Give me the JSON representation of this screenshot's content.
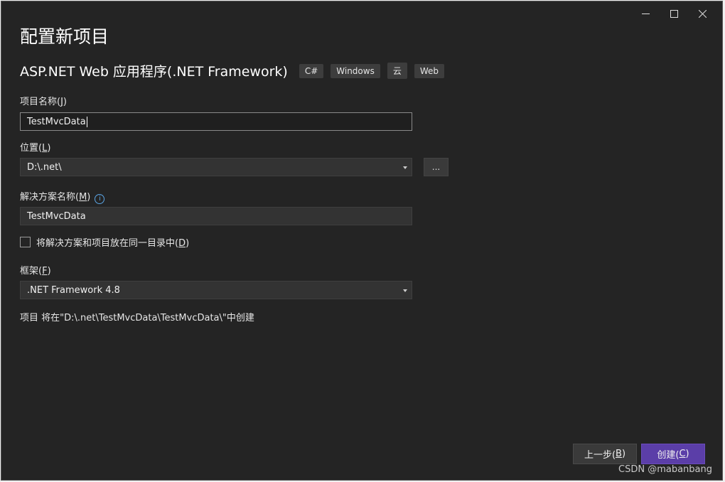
{
  "window": {
    "title": "配置新项目",
    "controls": {
      "minimize_icon": "minimize-icon",
      "maximize_icon": "maximize-icon",
      "close_icon": "close-icon"
    }
  },
  "project_type": {
    "name": "ASP.NET Web 应用程序(.NET Framework)",
    "tags": [
      "C#",
      "Windows",
      "云",
      "Web"
    ]
  },
  "form": {
    "project_name": {
      "label": "项目名称(",
      "mnemonic": "J",
      "label_end": ")",
      "value": "TestMvcData"
    },
    "location": {
      "label": "位置(",
      "mnemonic": "L",
      "label_end": ")",
      "value": "D:\\.net\\",
      "browse_label": "..."
    },
    "solution_name": {
      "label": "解决方案名称(",
      "mnemonic": "M",
      "label_end": ")",
      "value": "TestMvcData",
      "info_icon": "info-icon"
    },
    "same_dir": {
      "label": "将解决方案和项目放在同一目录中(",
      "mnemonic": "D",
      "label_end": ")",
      "checked": false
    },
    "framework": {
      "label": "框架(",
      "mnemonic": "F",
      "label_end": ")",
      "value": ".NET Framework 4.8"
    },
    "path_note": "项目 将在\"D:\\.net\\TestMvcData\\TestMvcData\\\"中创建"
  },
  "buttons": {
    "back": {
      "label": "上一步(",
      "mnemonic": "B",
      "label_end": ")"
    },
    "create": {
      "label": "创建(",
      "mnemonic": "C",
      "label_end": ")"
    }
  },
  "watermark": "CSDN @mabanbang",
  "colors": {
    "background": "#242424",
    "accent": "#5b3ea8",
    "info": "#5ba6e6"
  }
}
